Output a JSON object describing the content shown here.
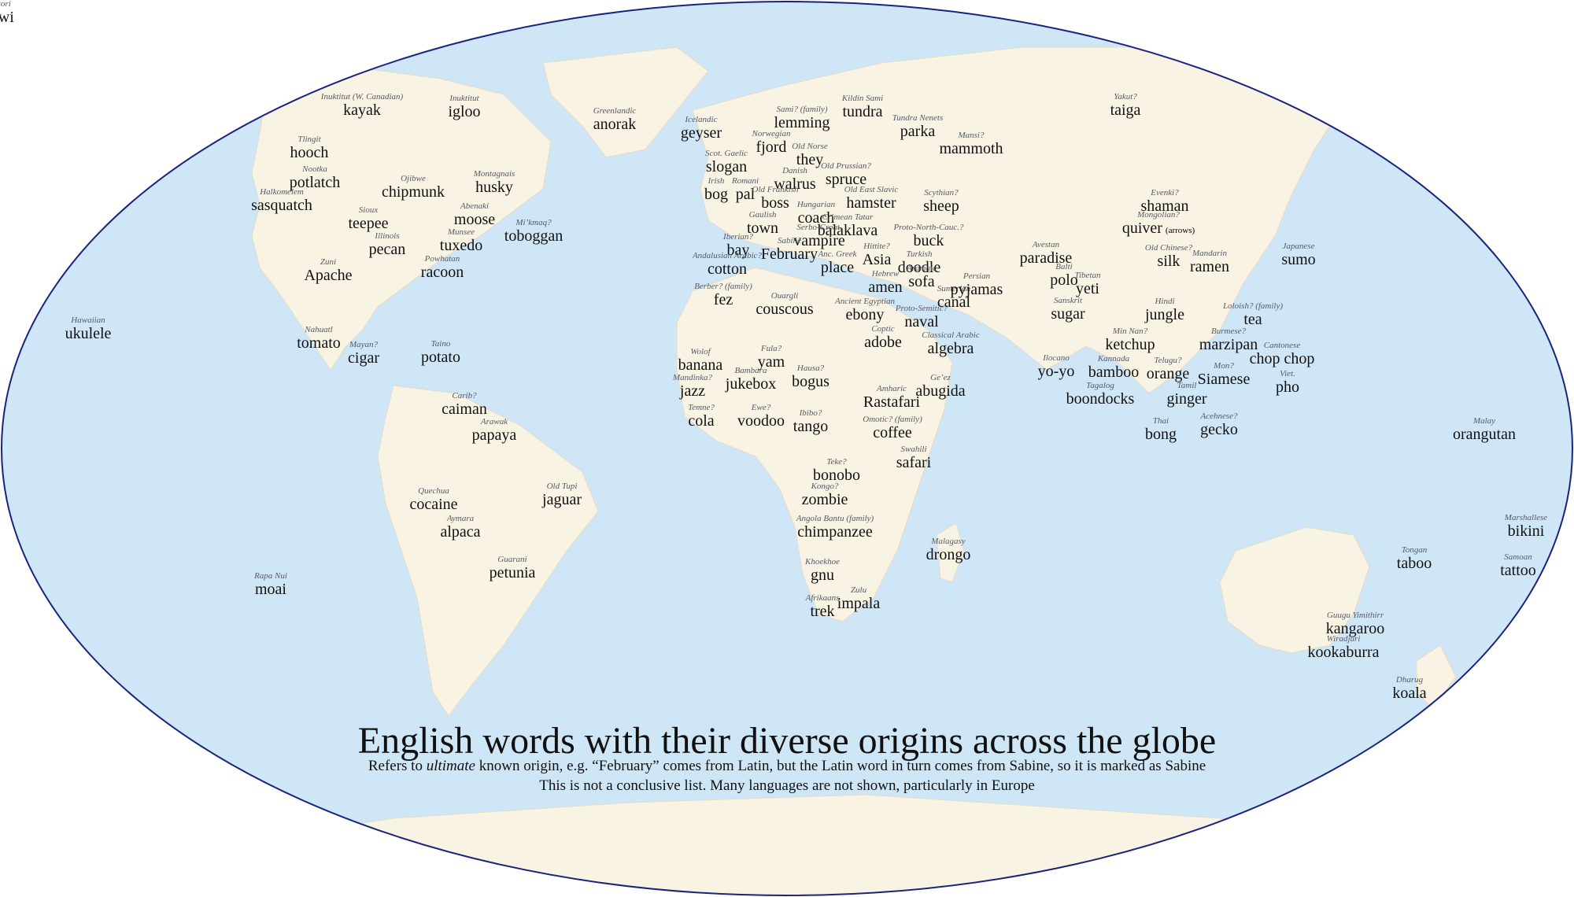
{
  "colors": {
    "ocean": "#cfe6f7",
    "land": "#f8f3e3",
    "border": "#1a237e"
  },
  "title": "English words with their diverse origins across the globe",
  "subtitle_parts": [
    "Refers to ",
    "ultimate",
    " known origin, e.g. “February” comes from Latin, but the Latin word in turn comes from Sabine, so it is marked as Sabine"
  ],
  "note": "This is not a conclusive list. Many languages are not shown, particularly in Europe",
  "words": [
    {
      "lang": "Inuktitut (W. Canadian)",
      "word": "kayak"
    },
    {
      "lang": "Inuktitut",
      "word": "igloo"
    },
    {
      "lang": "Tlingit",
      "word": "hooch"
    },
    {
      "lang": "Nootka",
      "word": "potlatch"
    },
    {
      "lang": "Halkomelem",
      "word": "sasquatch"
    },
    {
      "lang": "Ojibwe",
      "word": "chipmunk"
    },
    {
      "lang": "Montagnais",
      "word": "husky"
    },
    {
      "lang": "Sioux",
      "word": "teepee"
    },
    {
      "lang": "Abenaki",
      "word": "moose"
    },
    {
      "lang": "Mi’kmaq?",
      "word": "toboggan"
    },
    {
      "lang": "Illinois",
      "word": "pecan"
    },
    {
      "lang": "Munsee",
      "word": "tuxedo"
    },
    {
      "lang": "Zuni",
      "word": "Apache"
    },
    {
      "lang": "Powhatan",
      "word": "racoon"
    },
    {
      "lang": "Hawaiian",
      "word": "ukulele"
    },
    {
      "lang": "Nahuatl",
      "word": "tomato"
    },
    {
      "lang": "Mayan?",
      "word": "cigar"
    },
    {
      "lang": "Taino",
      "word": "potato"
    },
    {
      "lang": "Carib?",
      "word": "caiman"
    },
    {
      "lang": "Arawak",
      "word": "papaya"
    },
    {
      "lang": "Quechua",
      "word": "cocaine"
    },
    {
      "lang": "Old Tupi",
      "word": "jaguar"
    },
    {
      "lang": "Aymara",
      "word": "alpaca"
    },
    {
      "lang": "Guarani",
      "word": "petunia"
    },
    {
      "lang": "Rapa Nui",
      "word": "moai"
    },
    {
      "lang": "Greenlandic",
      "word": "anorak"
    },
    {
      "lang": "Icelandic",
      "word": "geyser"
    },
    {
      "lang": "Sami? (family)",
      "word": "lemming"
    },
    {
      "lang": "Kildin Sami",
      "word": "tundra"
    },
    {
      "lang": "Tundra Nenets",
      "word": "parka"
    },
    {
      "lang": "Norwegian",
      "word": "fjord"
    },
    {
      "lang": "Old Norse",
      "word": "they"
    },
    {
      "lang": "Mansi?",
      "word": "mammoth"
    },
    {
      "lang": "Scot. Gaelic",
      "word": "slogan"
    },
    {
      "lang": "Danish",
      "word": "walrus"
    },
    {
      "lang": "Old Prussian?",
      "word": "spruce"
    },
    {
      "lang": "Irish",
      "word": "bog"
    },
    {
      "lang": "Romani",
      "word": "pal"
    },
    {
      "lang": "Old Frankish",
      "word": "boss"
    },
    {
      "lang": "Old East Slavic",
      "word": "hamster"
    },
    {
      "lang": "Scythian?",
      "word": "sheep"
    },
    {
      "lang": "Hungarian",
      "word": "coach"
    },
    {
      "lang": "Gaulish",
      "word": "town"
    },
    {
      "lang": "Crimean Tatar",
      "word": "balaklava"
    },
    {
      "lang": "Serbo-Croat.",
      "word": "vampire"
    },
    {
      "lang": "Iberian?",
      "word": "bay"
    },
    {
      "lang": "Sabine",
      "word": "February"
    },
    {
      "lang": "Proto-North-Cauc.?",
      "word": "buck"
    },
    {
      "lang": "Hittite?",
      "word": "Asia"
    },
    {
      "lang": "Turkish",
      "word": "doodle"
    },
    {
      "lang": "Anc. Greek",
      "word": "place"
    },
    {
      "lang": "Andalusian Arabic?",
      "word": "cotton"
    },
    {
      "lang": "Hebrew",
      "word": "amen"
    },
    {
      "lang": "Aramaic",
      "word": "sofa"
    },
    {
      "lang": "Sumerian",
      "word": "canal"
    },
    {
      "lang": "Persian",
      "word": "pyjamas"
    },
    {
      "lang": "Avestan",
      "word": "paradise"
    },
    {
      "lang": "Balti",
      "word": "polo"
    },
    {
      "lang": "Berber? (family)",
      "word": "fez"
    },
    {
      "lang": "Ouargli",
      "word": "couscous"
    },
    {
      "lang": "Ancient Egyptian",
      "word": "ebony"
    },
    {
      "lang": "Proto-Semitic?",
      "word": "naval"
    },
    {
      "lang": "Coptic",
      "word": "adobe"
    },
    {
      "lang": "Classical Arabic",
      "word": "algebra"
    },
    {
      "lang": "Wolof",
      "word": "banana"
    },
    {
      "lang": "Fula?",
      "word": "yam"
    },
    {
      "lang": "Hausa?",
      "word": "bogus"
    },
    {
      "lang": "Mandinka?",
      "word": "jazz"
    },
    {
      "lang": "Bambara",
      "word": "jukebox"
    },
    {
      "lang": "Temne?",
      "word": "cola"
    },
    {
      "lang": "Ewe?",
      "word": "voodoo"
    },
    {
      "lang": "Ibibo?",
      "word": "tango"
    },
    {
      "lang": "Amharic",
      "word": "Rastafari"
    },
    {
      "lang": "Ge’ez",
      "word": "abugida"
    },
    {
      "lang": "Omotic? (family)",
      "word": "coffee"
    },
    {
      "lang": "Swahili",
      "word": "safari"
    },
    {
      "lang": "Teke?",
      "word": "bonobo"
    },
    {
      "lang": "Kongo?",
      "word": "zombie"
    },
    {
      "lang": "Angola Bantu (family)",
      "word": "chimpanzee"
    },
    {
      "lang": "Malagasy",
      "word": "drongo"
    },
    {
      "lang": "Khoekhoe",
      "word": "gnu"
    },
    {
      "lang": "Zulu",
      "word": "impala"
    },
    {
      "lang": "Afrikaans",
      "word": "trek"
    },
    {
      "lang": "Yakut?",
      "word": "taiga"
    },
    {
      "lang": "Evenki?",
      "word": "shaman"
    },
    {
      "lang": "Mongolian?",
      "word": "quiver",
      "note": "(arrows)"
    },
    {
      "lang": "Old Chinese?",
      "word": "silk"
    },
    {
      "lang": "Mandarin",
      "word": "ramen"
    },
    {
      "lang": "Japanese",
      "word": "sumo"
    },
    {
      "lang": "Tibetan",
      "word": "yeti"
    },
    {
      "lang": "Sanskrit",
      "word": "sugar"
    },
    {
      "lang": "Hindi",
      "word": "jungle"
    },
    {
      "lang": "Loloish? (family)",
      "word": "tea"
    },
    {
      "lang": "Min Nan?",
      "word": "ketchup"
    },
    {
      "lang": "Burmese?",
      "word": "marzipan"
    },
    {
      "lang": "Cantonese",
      "word": "chop chop"
    },
    {
      "lang": "Ilocano",
      "word": "yo-yo"
    },
    {
      "lang": "Kannada",
      "word": "bamboo"
    },
    {
      "lang": "Telugu?",
      "word": "orange"
    },
    {
      "lang": "Mon?",
      "word": "Siamese"
    },
    {
      "lang": "Viet.",
      "word": "pho"
    },
    {
      "lang": "Tagalog",
      "word": "boondocks"
    },
    {
      "lang": "Tamil",
      "word": "ginger"
    },
    {
      "lang": "Thai",
      "word": "bong"
    },
    {
      "lang": "Acehnese?",
      "word": "gecko"
    },
    {
      "lang": "Malay",
      "word": "orangutan"
    },
    {
      "lang": "Marshallese",
      "word": "bikini"
    },
    {
      "lang": "Samoan",
      "word": "tattoo"
    },
    {
      "lang": "Tongan",
      "word": "taboo"
    },
    {
      "lang": "Guugu Yimithirr",
      "word": "kangaroo"
    },
    {
      "lang": "Wiradjuri",
      "word": "kookaburra"
    },
    {
      "lang": "Dharug",
      "word": "koala"
    },
    {
      "lang": "Maori",
      "word": "kiwi"
    }
  ]
}
